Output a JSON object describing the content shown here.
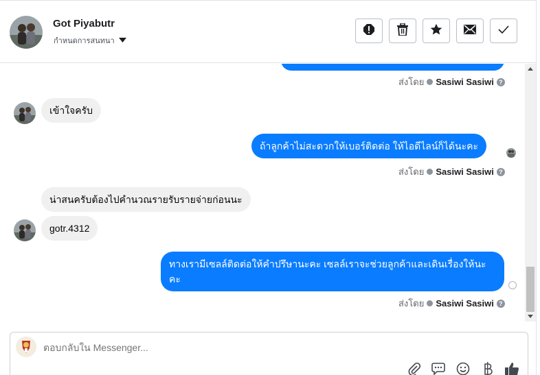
{
  "header": {
    "name": "Got Piyabutr",
    "subtitle": "กำหนดการสนทนา",
    "actions": [
      {
        "icon": "alert-icon"
      },
      {
        "icon": "trash-icon"
      },
      {
        "icon": "star-icon"
      },
      {
        "icon": "mail-icon"
      },
      {
        "icon": "check-icon"
      }
    ]
  },
  "thread": {
    "sent_by_label": "ส่งโดย",
    "sender": "Sasiwi Sasiwi",
    "help_glyph": "?",
    "messages": [
      {
        "dir": "in",
        "text": "เข้าใจครับ"
      },
      {
        "dir": "out",
        "text": "ถ้าลูกค้าไม่สะดวกให้เบอร์ติดต่อ ให้ไอดีไลน์ก็ได้นะคะ"
      },
      {
        "dir": "in",
        "text": "น่าสนครับต้องไปคำนวณรายรับรายจ่ายก่อนนะ"
      },
      {
        "dir": "in",
        "text": "gotr.4312"
      },
      {
        "dir": "out",
        "text": "ทางเรามีเซลล์ติดต่อให้คำปรึษานะคะ เซลล์เราจะช่วยลูกค้าและเดินเรื่องให้นะคะ"
      }
    ]
  },
  "composer": {
    "placeholder": "ตอบกลับใน Messenger..."
  },
  "colors": {
    "outgoing_bubble": "#0a7cff",
    "incoming_bubble": "#f0f0f0",
    "border": "#dfe3e8"
  }
}
